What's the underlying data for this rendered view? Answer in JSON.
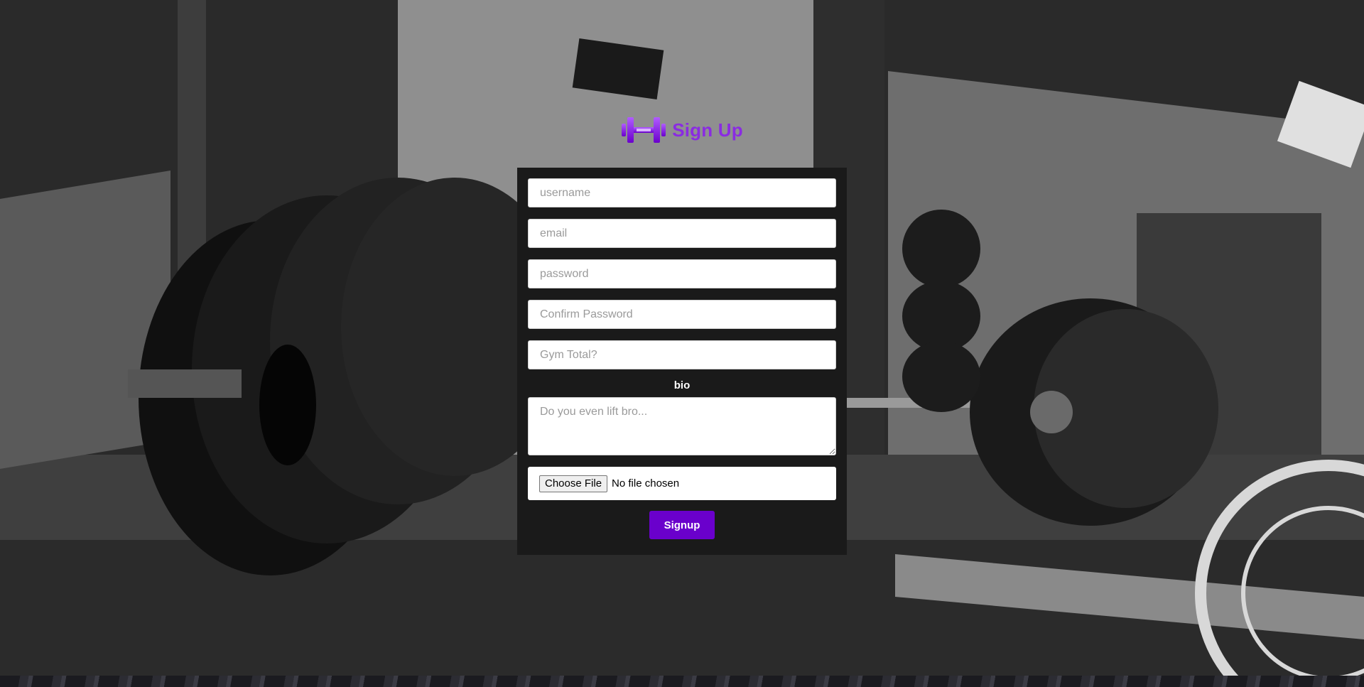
{
  "brand": {
    "title": "Sign Up",
    "icon": "dumbbell-icon",
    "accent_color": "#8a2be2"
  },
  "form": {
    "username_placeholder": "username",
    "email_placeholder": "email",
    "password_placeholder": "password",
    "confirm_password_placeholder": "Confirm Password",
    "gym_total_placeholder": "Gym Total?",
    "bio_label": "bio",
    "bio_placeholder": "Do you even lift bro...",
    "file_button_label": "Choose File",
    "file_status": "No file chosen",
    "submit_label": "Signup",
    "submit_color": "#6a00cc"
  }
}
